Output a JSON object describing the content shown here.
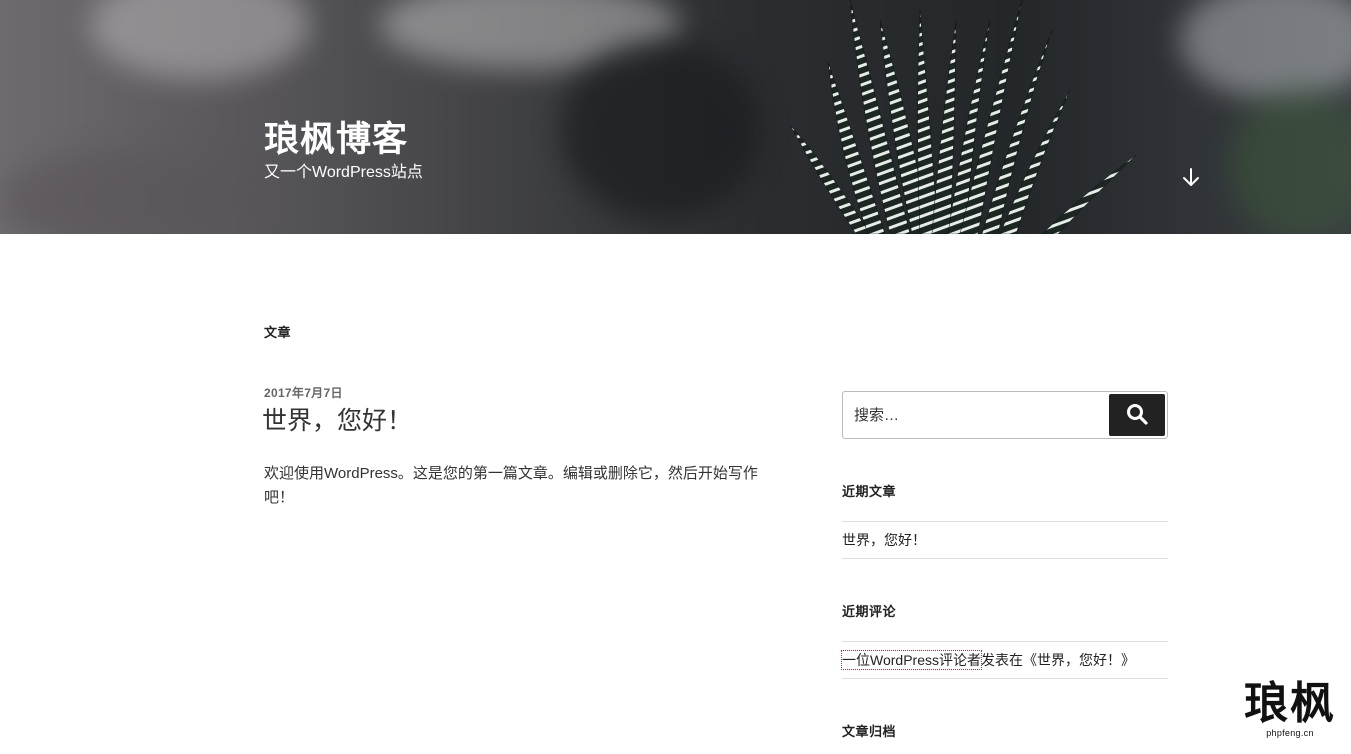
{
  "header": {
    "site_title": "琅枫博客",
    "site_description": "又一个WordPress站点",
    "scroll_icon": "arrow-down-icon"
  },
  "main": {
    "page_heading": "文章",
    "posts": [
      {
        "date": "2017年7月7日",
        "title": "世界，您好！",
        "excerpt": "欢迎使用WordPress。这是您的第一篇文章。编辑或删除它，然后开始写作吧！"
      }
    ]
  },
  "sidebar": {
    "search": {
      "placeholder": "搜索…",
      "button_icon": "search-icon"
    },
    "recent_posts": {
      "title": "近期文章",
      "items": [
        "世界，您好！"
      ]
    },
    "recent_comments": {
      "title": "近期评论",
      "items": [
        {
          "author": "一位WordPress评论者",
          "connector": "发表在《",
          "post": "世界，您好！",
          "close": "》"
        }
      ]
    },
    "archives": {
      "title": "文章归档"
    }
  },
  "watermark": {
    "logo_text": "琅枫",
    "domain": "phpfeng.cn"
  },
  "colors": {
    "header_text": "#ffffff",
    "body_text": "#222222",
    "meta_text": "#666666",
    "search_button": "#222222",
    "divider": "#dddddd"
  }
}
